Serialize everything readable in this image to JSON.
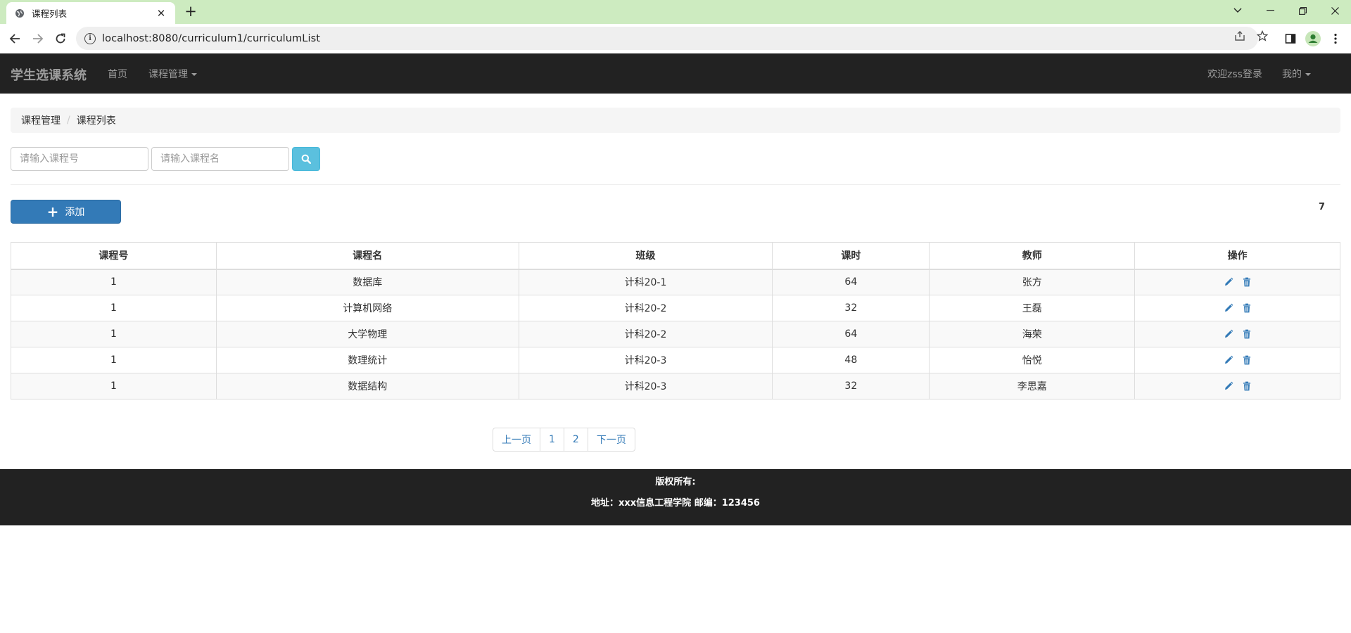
{
  "browser": {
    "tab_title": "课程列表",
    "url": "localhost:8080/curriculum1/curriculumList"
  },
  "navbar": {
    "brand": "学生选课系统",
    "home": "首页",
    "course_manage": "课程管理",
    "welcome": "欢迎zss登录",
    "mine": "我的"
  },
  "breadcrumb": {
    "items": [
      "课程管理",
      "课程列表"
    ],
    "separator": "/"
  },
  "search": {
    "course_no_placeholder": "请输入课程号",
    "course_name_placeholder": "请输入课程名"
  },
  "toolbar": {
    "add_label": "添加",
    "add_icon": "plus-icon",
    "count": "7"
  },
  "table": {
    "headers": [
      "课程号",
      "课程名",
      "班级",
      "课时",
      "教师",
      "操作"
    ],
    "rows": [
      [
        "1",
        "数据库",
        "计科20-1",
        "64",
        "张方"
      ],
      [
        "1",
        "计算机网络",
        "计科20-2",
        "32",
        "王磊"
      ],
      [
        "1",
        "大学物理",
        "计科20-2",
        "64",
        "海荣"
      ],
      [
        "1",
        "数理统计",
        "计科20-3",
        "48",
        "怡悦"
      ],
      [
        "1",
        "数据结构",
        "计科20-3",
        "32",
        "李思嘉"
      ]
    ],
    "action_icons": [
      "pencil-icon",
      "trash-icon"
    ]
  },
  "pagination": {
    "prev": "上一页",
    "pages": [
      "1",
      "2"
    ],
    "next": "下一页"
  },
  "footer": {
    "line1": "版权所有:",
    "line2": "地址：xxx信息工程学院 邮编：123456"
  },
  "colors": {
    "navbar_bg": "#222222",
    "primary": "#337ab7",
    "info": "#5bc0de",
    "tabbar_bg": "#cdebc0"
  }
}
